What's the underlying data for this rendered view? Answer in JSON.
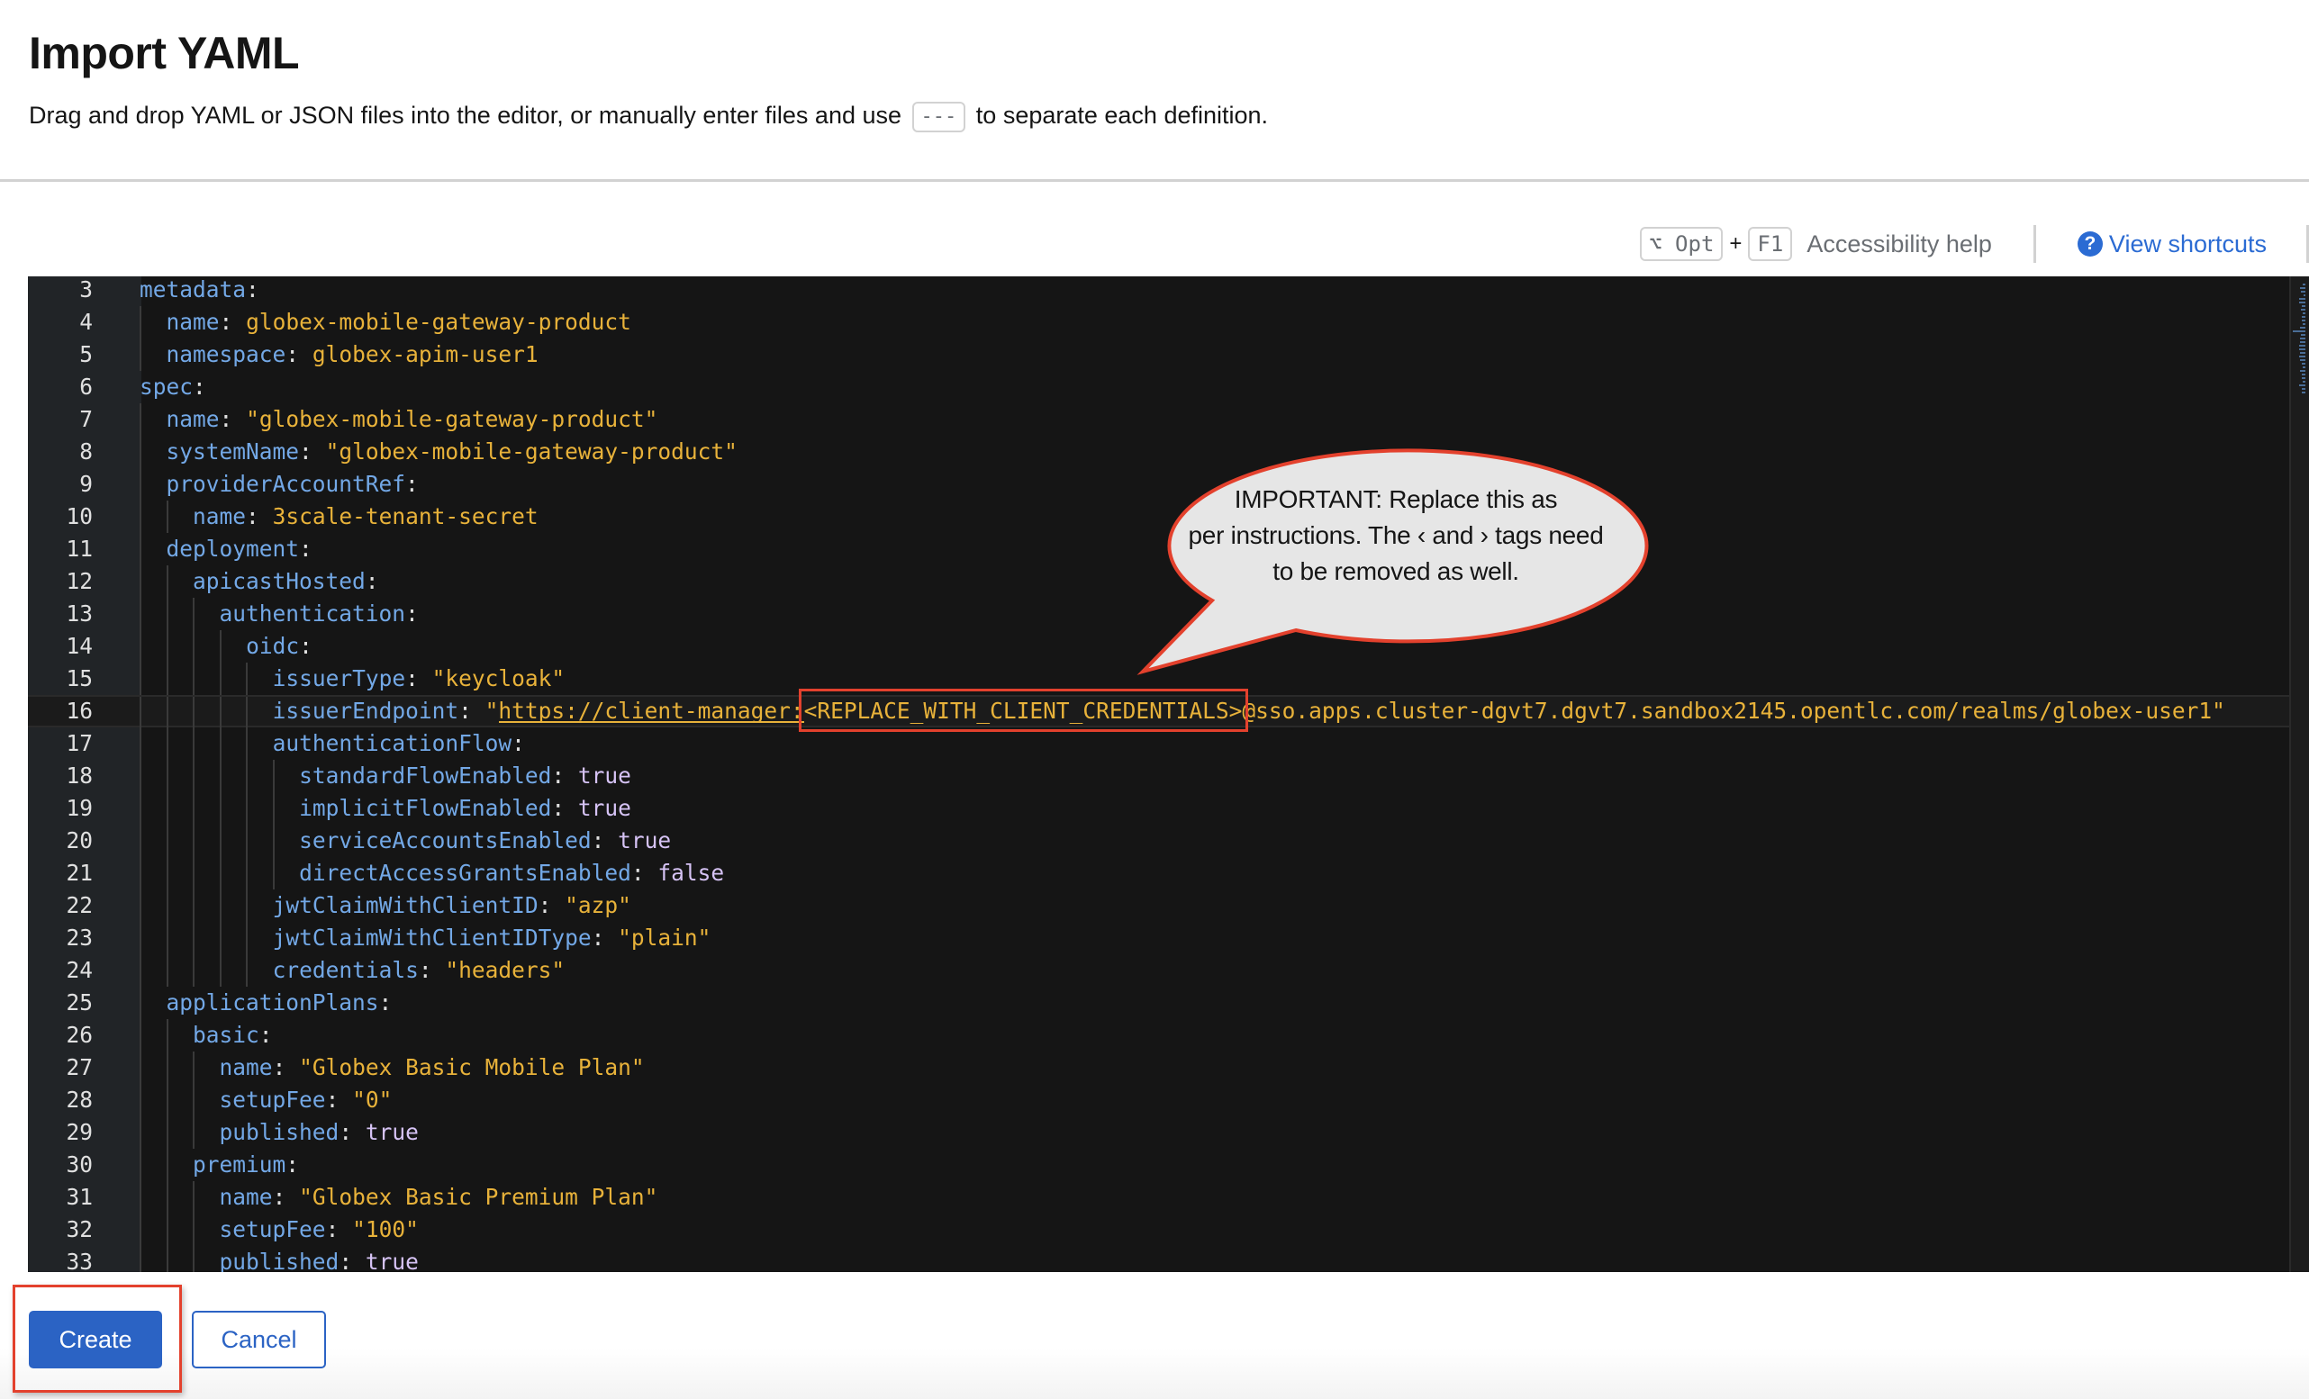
{
  "header": {
    "title": "Import YAML",
    "subtitle_before": "Drag and drop YAML or JSON files into the editor, or manually enter files and use",
    "separator": "---",
    "subtitle_after": "to separate each definition."
  },
  "toolbar": {
    "opt_key": "⌥ Opt",
    "plus": "+",
    "f1_key": "F1",
    "accessibility_help": "Accessibility help",
    "view_shortcuts": "View shortcuts",
    "help_icon": "question-circle-icon"
  },
  "editor": {
    "current_line": 16,
    "placeholder": "<REPLACE_WITH_CLIENT_CREDENTIALS>",
    "link_prefix": "https://client-manager:",
    "lines": [
      {
        "n": 3,
        "indent": 0,
        "key": "metadata",
        "value": "",
        "type": ""
      },
      {
        "n": 4,
        "indent": 2,
        "key": "name",
        "value": "globex-mobile-gateway-product",
        "type": "string"
      },
      {
        "n": 5,
        "indent": 2,
        "key": "namespace",
        "value": "globex-apim-user1",
        "type": "string"
      },
      {
        "n": 6,
        "indent": 0,
        "key": "spec",
        "value": "",
        "type": ""
      },
      {
        "n": 7,
        "indent": 2,
        "key": "name",
        "value": "\"globex-mobile-gateway-product\"",
        "type": "string"
      },
      {
        "n": 8,
        "indent": 2,
        "key": "systemName",
        "value": "\"globex-mobile-gateway-product\"",
        "type": "string"
      },
      {
        "n": 9,
        "indent": 2,
        "key": "providerAccountRef",
        "value": "",
        "type": ""
      },
      {
        "n": 10,
        "indent": 4,
        "key": "name",
        "value": "3scale-tenant-secret",
        "type": "string"
      },
      {
        "n": 11,
        "indent": 2,
        "key": "deployment",
        "value": "",
        "type": ""
      },
      {
        "n": 12,
        "indent": 4,
        "key": "apicastHosted",
        "value": "",
        "type": ""
      },
      {
        "n": 13,
        "indent": 6,
        "key": "authentication",
        "value": "",
        "type": ""
      },
      {
        "n": 14,
        "indent": 8,
        "key": "oidc",
        "value": "",
        "type": ""
      },
      {
        "n": 15,
        "indent": 10,
        "key": "issuerType",
        "value": "\"keycloak\"",
        "type": "string"
      },
      {
        "n": 16,
        "indent": 10,
        "key": "issuerEndpoint",
        "value": "\"https://client-manager:<REPLACE_WITH_CLIENT_CREDENTIALS>@sso.apps.cluster-dgvt7.dgvt7.sandbox2145.opentlc.com/realms/globex-user1\"",
        "type": "url"
      },
      {
        "n": 17,
        "indent": 10,
        "key": "authenticationFlow",
        "value": "",
        "type": ""
      },
      {
        "n": 18,
        "indent": 12,
        "key": "standardFlowEnabled",
        "value": "true",
        "type": "bool"
      },
      {
        "n": 19,
        "indent": 12,
        "key": "implicitFlowEnabled",
        "value": "true",
        "type": "bool"
      },
      {
        "n": 20,
        "indent": 12,
        "key": "serviceAccountsEnabled",
        "value": "true",
        "type": "bool"
      },
      {
        "n": 21,
        "indent": 12,
        "key": "directAccessGrantsEnabled",
        "value": "false",
        "type": "bool"
      },
      {
        "n": 22,
        "indent": 10,
        "key": "jwtClaimWithClientID",
        "value": "\"azp\"",
        "type": "string"
      },
      {
        "n": 23,
        "indent": 10,
        "key": "jwtClaimWithClientIDType",
        "value": "\"plain\"",
        "type": "string"
      },
      {
        "n": 24,
        "indent": 10,
        "key": "credentials",
        "value": "\"headers\"",
        "type": "string"
      },
      {
        "n": 25,
        "indent": 2,
        "key": "applicationPlans",
        "value": "",
        "type": ""
      },
      {
        "n": 26,
        "indent": 4,
        "key": "basic",
        "value": "",
        "type": ""
      },
      {
        "n": 27,
        "indent": 6,
        "key": "name",
        "value": "\"Globex Basic Mobile Plan\"",
        "type": "string"
      },
      {
        "n": 28,
        "indent": 6,
        "key": "setupFee",
        "value": "\"0\"",
        "type": "string"
      },
      {
        "n": 29,
        "indent": 6,
        "key": "published",
        "value": "true",
        "type": "bool"
      },
      {
        "n": 30,
        "indent": 4,
        "key": "premium",
        "value": "",
        "type": ""
      },
      {
        "n": 31,
        "indent": 6,
        "key": "name",
        "value": "\"Globex Basic Premium Plan\"",
        "type": "string"
      },
      {
        "n": 32,
        "indent": 6,
        "key": "setupFee",
        "value": "\"100\"",
        "type": "string"
      },
      {
        "n": 33,
        "indent": 6,
        "key": "published",
        "value": "true",
        "type": "bool"
      }
    ]
  },
  "callout": {
    "line1": "IMPORTANT: Replace this as",
    "line2": "per instructions. The ‹ and › tags need",
    "line3": "to be removed as well."
  },
  "footer": {
    "create_label": "Create",
    "cancel_label": "Cancel"
  },
  "colors": {
    "primary": "#2b63c4",
    "annotation_red": "#e3412d",
    "yaml_key": "#73a8e6",
    "yaml_string": "#e8b23a",
    "yaml_bool": "#d6c3f5",
    "editor_bg": "#151515"
  }
}
